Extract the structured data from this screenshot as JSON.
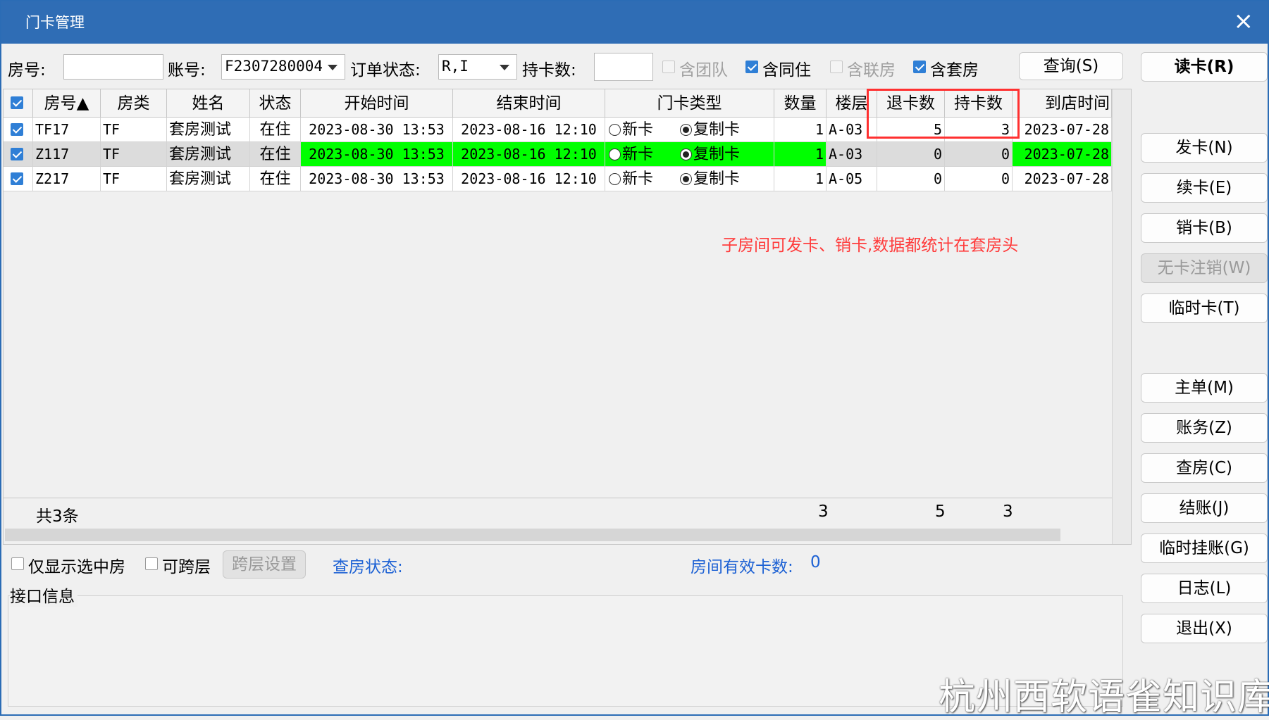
{
  "window": {
    "title": "门卡管理",
    "close": "×"
  },
  "filters": {
    "room_label": "房号:",
    "room_value": "",
    "account_label": "账号:",
    "account_value": "F2307280004",
    "order_status_label": "订单状态:",
    "order_status_value": "R,I",
    "card_count_label": "持卡数:",
    "card_count_value": "",
    "include_group": {
      "label": "含团队",
      "checked": false,
      "enabled": false
    },
    "include_cohabit": {
      "label": "含同住",
      "checked": true,
      "enabled": true
    },
    "include_linked": {
      "label": "含联房",
      "checked": false,
      "enabled": false
    },
    "include_suite": {
      "label": "含套房",
      "checked": true,
      "enabled": true
    },
    "query_button": "查询(S)"
  },
  "grid": {
    "headers": [
      "房号▲",
      "房类",
      "姓名",
      "状态",
      "开始时间",
      "结束时间",
      "门卡类型",
      "数量",
      "楼层",
      "退卡数",
      "持卡数",
      "到店时间"
    ],
    "card_type_options": [
      "新卡",
      "复制卡"
    ],
    "rows": [
      {
        "room": "TF17",
        "type": "TF",
        "name": "套房测试",
        "status": "在住",
        "start": "2023-08-30 13:53",
        "end": "2023-08-16 12:10",
        "card_type": "复制卡",
        "qty": "1",
        "floor": "A-03",
        "returned": "5",
        "holding": "3",
        "arrival": "2023-07-28"
      },
      {
        "room": "Z117",
        "type": "TF",
        "name": "套房测试",
        "status": "在住",
        "start": "2023-08-30 13:53",
        "end": "2023-08-16 12:10",
        "card_type": "复制卡",
        "qty": "1",
        "floor": "A-03",
        "returned": "0",
        "holding": "0",
        "arrival": "2023-07-28"
      },
      {
        "room": "Z217",
        "type": "TF",
        "name": "套房测试",
        "status": "在住",
        "start": "2023-08-30 13:53",
        "end": "2023-08-16 12:10",
        "card_type": "复制卡",
        "qty": "1",
        "floor": "A-05",
        "returned": "0",
        "holding": "0",
        "arrival": "2023-07-28"
      }
    ],
    "footer": {
      "total": "共3条",
      "qty_sum": "3",
      "returned_sum": "5",
      "holding_sum": "3"
    }
  },
  "annotation": "子房间可发卡、销卡,数据都统计在套房头",
  "bottom": {
    "only_selected": "仅显示选中房",
    "cross_floor": "可跨层",
    "cross_floor_settings": "跨层设置",
    "checkout_status": "查房状态:",
    "valid_cards_label": "房间有效卡数:",
    "valid_cards_value": "0",
    "interface_info": "接口信息"
  },
  "actions": {
    "read_card": "读卡(R)",
    "issue_card": "发卡(N)",
    "renew_card": "续卡(E)",
    "cancel_card": "销卡(B)",
    "cardless_cancel": "无卡注销(W)",
    "temp_card": "临时卡(T)",
    "main_order": "主单(M)",
    "billing": "账务(Z)",
    "room_check": "查房(C)",
    "checkout": "结账(J)",
    "temp_charge": "临时挂账(G)",
    "log": "日志(L)",
    "exit": "退出(X)"
  },
  "watermark": "杭州西软语雀知识库",
  "colors": {
    "titlebar": "#2f6db5",
    "highlight": "#00ff00",
    "annotation": "#ff3b3b",
    "link": "#1e62d4"
  }
}
